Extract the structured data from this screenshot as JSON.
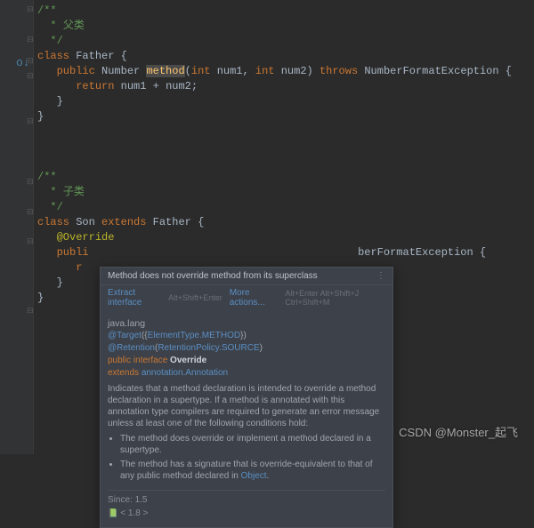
{
  "code": {
    "c1": "/**",
    "c2a": " * ",
    "c2b": "父类",
    "c3": " */",
    "l4_kw1": "class",
    "l4_cls": "Father",
    "l4_br": "{",
    "l5_kw1": "public",
    "l5_type": "Number",
    "l5_method": "method",
    "l5_p1_open": "(",
    "l5_p1_type": "int",
    "l5_p1_name": "num1",
    "l5_comma": ", ",
    "l5_p2_type": "int",
    "l5_p2_name": "num2",
    "l5_p2_close": ")",
    "l5_kw2": "throws",
    "l5_exc": "NumberFormatException",
    "l5_br": "{",
    "l6_kw": "return",
    "l6_v1": "num1",
    "l6_op": " + ",
    "l6_v2": "num2",
    "l6_semi": ";",
    "l7_br": "}",
    "l8_br": "}",
    "c9": "/**",
    "c10a": " * ",
    "c10b": "子类",
    "c11": " */",
    "l12_kw1": "class",
    "l12_cls": "Son",
    "l12_kw2": "extends",
    "l12_sup": "Father",
    "l12_br": "{",
    "l13_ann": "@Override",
    "l14_kw1": "publi",
    "l14_exc_tail": "berFormatException {",
    "l15_r": "r",
    "l16_br": "}",
    "l17_br": "}"
  },
  "popup": {
    "title": "Method does not override method from its superclass",
    "more_icon": "⋮",
    "action1": "Extract interface",
    "action1_sc": "Alt+Shift+Enter",
    "action2": "More actions...",
    "action2_sc": "Alt+Enter Alt+Shift+J Ctrl+Shift+M",
    "pkg": "java.lang",
    "ann_target1": "@Target",
    "ann_target2": "({",
    "ann_et": "ElementType.METHOD",
    "ann_target3": "})",
    "ann_ret1": "@Retention",
    "ann_ret2": "(",
    "ann_rp": "RetentionPolicy.SOURCE",
    "ann_ret3": ")",
    "decl1_kw1": "public interface",
    "decl1_name": "Override",
    "decl2_kw": "extends",
    "decl2_link": "annotation.Annotation",
    "desc": "Indicates that a method declaration is intended to override a method declaration in a supertype. If a method is annotated with this annotation type compilers are required to generate an error message unless at least one of the following conditions hold:",
    "bullet1": "The method does override or implement a method declared in a supertype.",
    "bullet2a": "The method has a signature that is override-equivalent to that of any public method declared in ",
    "bullet2b": "Object",
    "bullet2c": ".",
    "since_lbl": "Since:",
    "since_val": "1.5",
    "footer_icon": "📗",
    "footer_ver": "< 1.8 >"
  },
  "watermark": "CSDN @Monster_起飞"
}
